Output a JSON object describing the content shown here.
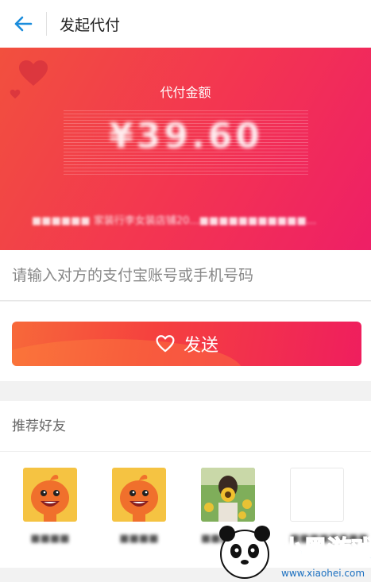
{
  "header": {
    "title": "发起代付",
    "back_icon": "arrow-left-icon"
  },
  "banner": {
    "label": "代付金额",
    "amount": "¥39.60",
    "description": "■■■■■■ 家装行李女装店铺20...■■■■■■■■■■■..."
  },
  "recipient": {
    "placeholder": "请输入对方的支付宝账号或手机号码",
    "value": ""
  },
  "send": {
    "label": "发送",
    "icon": "heart-outline-icon"
  },
  "friends": {
    "title": "推荐好友",
    "items": [
      {
        "name": "■■■■",
        "avatar": "cartoon-mascot"
      },
      {
        "name": "■■■■",
        "avatar": "cartoon-mascot"
      },
      {
        "name": "■■■■■■",
        "avatar": "sunflower-photo"
      },
      {
        "name": "■■■■■■■■",
        "avatar": "blank"
      }
    ]
  },
  "watermark": {
    "brand": "小黑游戏",
    "url": "www.xiaohei.com"
  },
  "colors": {
    "accent": "#f33452",
    "back_arrow": "#1a8cdc",
    "button_start": "#f7693a",
    "button_end": "#ef1e5e"
  }
}
